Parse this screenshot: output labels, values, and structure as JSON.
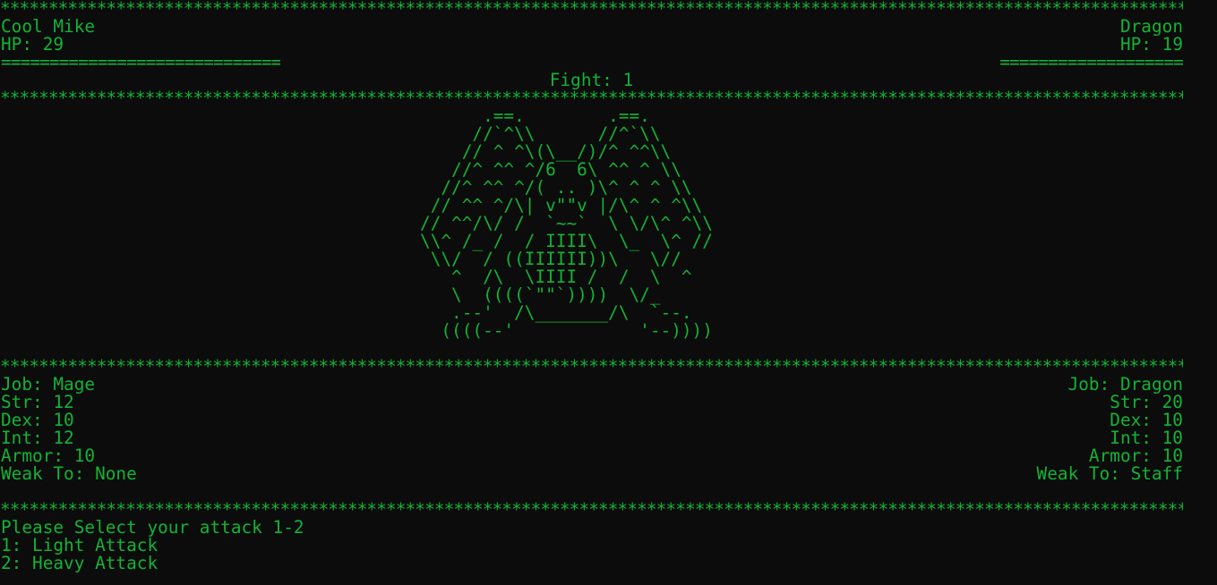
{
  "separator": "*****************************************************************************************************************************************************",
  "player": {
    "name": "Cool Mike",
    "hp": "HP: 29",
    "bar": "=============================",
    "stats": {
      "job": "Job: Mage",
      "str": "Str: 12",
      "dex": "Dex: 10",
      "int": "Int: 12",
      "armor": "Armor: 10",
      "weak": "Weak To: None"
    }
  },
  "enemy": {
    "name": "Dragon",
    "hp": "HP: 19",
    "bar": "===================",
    "stats": {
      "job": "Job: Dragon",
      "str": "Str: 20",
      "dex": "Dex: 10",
      "int": "Int: 10",
      "armor": "Armor: 10",
      "weak": "Weak To: Staff"
    }
  },
  "fight": "Fight: 1",
  "art": "         .==.        .==.\n        //`^\\\\      //^`\\\\\n       // ^ ^\\(\\__/)/^ ^^\\\\\n      //^ ^^ ^/6  6\\ ^^ ^ \\\\\n     //^ ^^ ^/( .. )\\^ ^ ^ \\\\\n    // ^^ ^/\\| v\"\"v |/\\^ ^ ^\\\\\n   // ^^/\\/ /  `~~`  \\ \\/\\^ ^\\\\\n   \\\\^ /_ /  / IIII\\  \\_  \\^ //\n    \\\\/  / ((IIIIII))\\   \\//\n      ^  /\\  \\IIII /  /  \\  ^\n      \\  ((((`\"\"`))))  \\/_\n      .--'  /\\_______/\\  `--.\n     ((((--'            '--))))",
  "prompt": {
    "question": "Please Select your attack 1-2",
    "options": [
      "1: Light Attack",
      "2: Heavy Attack"
    ]
  },
  "colors": {
    "background": "#0c0c0c",
    "text": "#13b335"
  }
}
